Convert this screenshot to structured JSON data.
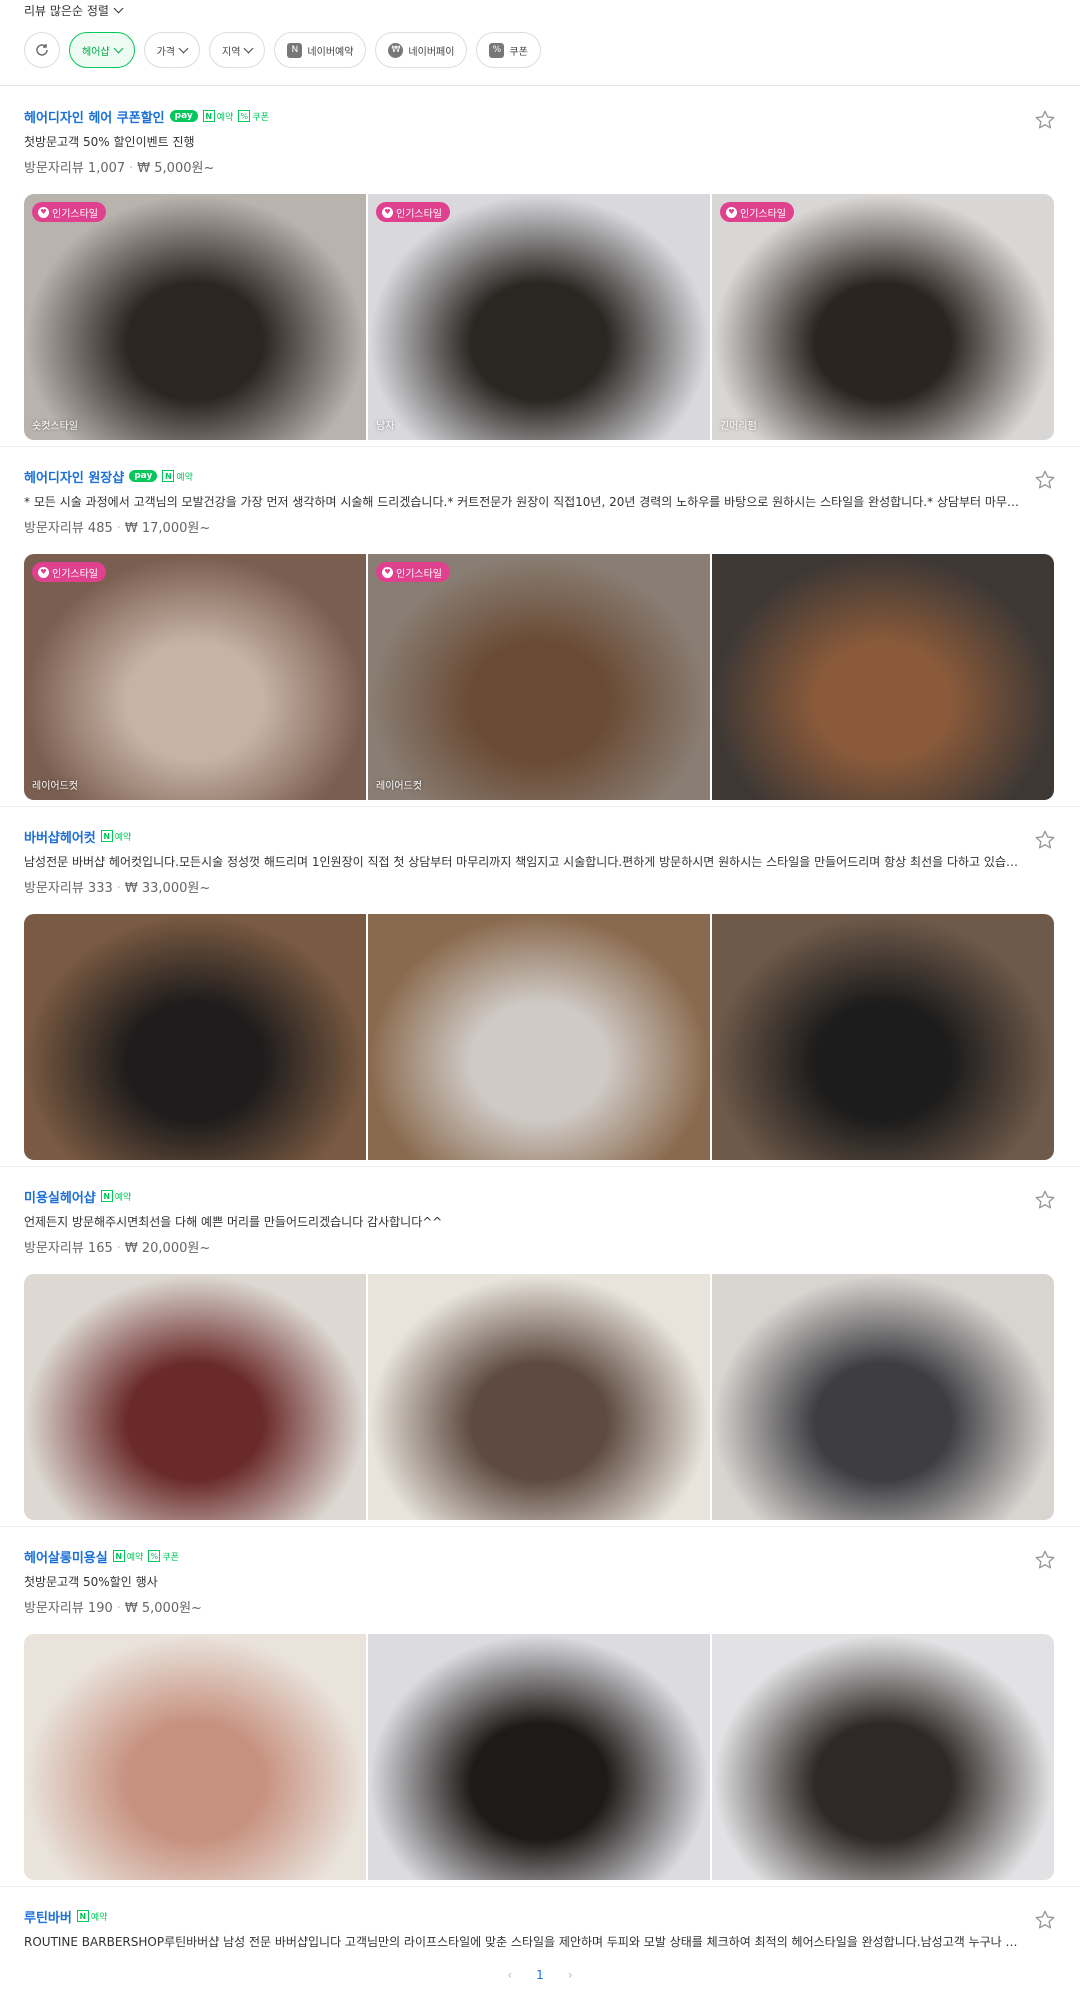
{
  "sort": {
    "label": "리뷰 많은순 정렬"
  },
  "filters": [
    {
      "label": "",
      "icon": "refresh-icon",
      "active": false
    },
    {
      "label": "헤어샵",
      "active": true,
      "chevron": true
    },
    {
      "label": "가격",
      "active": false,
      "chevron": true
    },
    {
      "label": "지역",
      "active": false,
      "chevron": true
    },
    {
      "label": "네이버예약",
      "active": false,
      "glyph": "N"
    },
    {
      "label": "네이버페이",
      "active": false,
      "glyph": "₩"
    },
    {
      "label": "쿠폰",
      "active": false,
      "glyph": "%"
    }
  ],
  "shops": [
    {
      "name": "헤어디자인 헤어 쿠폰할인",
      "pay": "pay",
      "reserve": "예약",
      "coupon": "쿠폰",
      "desc": "첫방문고객 50% 할인이벤트 진행",
      "reviews": "방문자리뷰 1,007",
      "price": "₩ 5,000원~",
      "photos": [
        {
          "tag": "인기스타일",
          "caption": "숏컷스타일",
          "colors": [
            "#b9b3ad",
            "#2b2622"
          ]
        },
        {
          "tag": "인기스타일",
          "caption": "남자",
          "colors": [
            "#d9d9dd",
            "#2a2622"
          ]
        },
        {
          "tag": "인기스타일",
          "caption": "긴머리펌",
          "colors": [
            "#d9d7d5",
            "#2c2420"
          ]
        }
      ]
    },
    {
      "name": "헤어디자인 원장샵",
      "pay": "pay",
      "reserve": "예약",
      "coupon": "",
      "desc": "* 모든 시술 과정에서 고객님의 모발건강을 가장 먼저 생각하며 시술해 드리겠습니다.* 커트전문가 원장이 직접10년, 20년 경력의 노하우를 바탕으로 원하시는 스타일을 완성합니다.* 상담부터 마무리까지 정성을 다해 최선을 다하겠습니다.원하는 스타일이 있으시면 편하게 말씀해주세요.* 주차가능합니다",
      "reviews": "방문자리뷰 485",
      "price": "₩ 17,000원~",
      "photos": [
        {
          "tag": "인기스타일",
          "caption": "레이어드컷",
          "colors": [
            "#7a5e50",
            "#c7b3a6"
          ]
        },
        {
          "tag": "인기스타일",
          "caption": "레이어드컷",
          "colors": [
            "#8a7e74",
            "#6a4a34"
          ]
        },
        {
          "tag": "",
          "caption": "",
          "colors": [
            "#3e3835",
            "#8a5a3a"
          ]
        }
      ]
    },
    {
      "name": "바버샵헤어컷",
      "pay": "",
      "reserve": "예약",
      "coupon": "",
      "desc": "남성전문 바버샵 헤어컷입니다.모든시술 정성껏 해드리며 1인원장이 직접 첫 상담부터 마무리까지 책임지고 시술합니다.편하게 방문하시면 원하시는 스타일을 만들어드리며 항상 최선을 다하고 있습니다 고객님들께 만족스러운 결과를 드리도록 노력하겠습니다.",
      "reviews": "방문자리뷰 333",
      "price": "₩ 33,000원~",
      "photos": [
        {
          "tag": "",
          "caption": "",
          "colors": [
            "#7a5a42",
            "#1e1c1c"
          ]
        },
        {
          "tag": "",
          "caption": "",
          "colors": [
            "#8a6a4e",
            "#cfcac6"
          ]
        },
        {
          "tag": "",
          "caption": "",
          "colors": [
            "#6f5a4a",
            "#1c1c1c"
          ]
        }
      ]
    },
    {
      "name": "미용실헤어샵",
      "pay": "",
      "reserve": "예약",
      "coupon": "",
      "desc": "언제든지 방문해주시면최선을 다해 예쁜 머리를 만들어드리겠습니다 감사합니다^^",
      "reviews": "방문자리뷰 165",
      "price": "₩ 20,000원~",
      "photos": [
        {
          "tag": "",
          "caption": "",
          "colors": [
            "#ddd8d2",
            "#6a2a2a"
          ]
        },
        {
          "tag": "",
          "caption": "",
          "colors": [
            "#e8e4dc",
            "#5e4a40"
          ]
        },
        {
          "tag": "",
          "caption": "",
          "colors": [
            "#d8d4d0",
            "#3e3e42"
          ]
        }
      ]
    },
    {
      "name": "헤어살롱미용실",
      "pay": "",
      "reserve": "예약",
      "coupon": "쿠폰",
      "desc": "첫방문고객 50%할인 행사",
      "reviews": "방문자리뷰 190",
      "price": "₩ 5,000원~",
      "photos": [
        {
          "tag": "",
          "caption": "",
          "colors": [
            "#e9e3dc",
            "#c7917f"
          ]
        },
        {
          "tag": "",
          "caption": "",
          "colors": [
            "#dcdce0",
            "#1e1a18"
          ]
        },
        {
          "tag": "",
          "caption": "",
          "colors": [
            "#e2e2e4",
            "#2e2826"
          ]
        }
      ]
    },
    {
      "name": "루틴바버",
      "pay": "",
      "reserve": "예약",
      "coupon": "",
      "desc": "ROUTINE BARBERSHOP루틴바버샵 남성 전문 바버샵입니다 고객님만의 라이프스타일에 맞춘 스타일을 제안하며 두피와 모발 상태를 체크하여 최적의 헤어스타일을 완성합니다.남성고객 누구나 편하게 방문해주세요.예약 우선으로 진행되며 워크인 고객도 가능합니다.항상 최선을 다하겠습니다.감사합니다",
      "reviews": "",
      "price": "",
      "photos": []
    }
  ],
  "pagination": {
    "prev": "‹",
    "current": "1",
    "next": "›"
  }
}
